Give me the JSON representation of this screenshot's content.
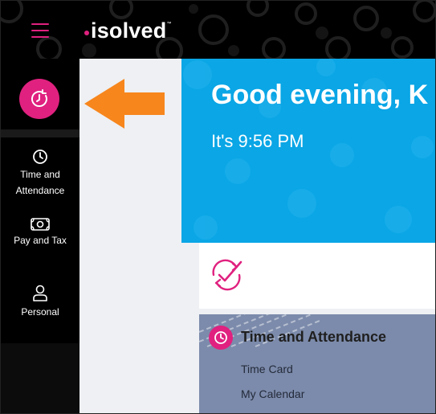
{
  "app": {
    "logo_text": "isolved",
    "logo_tm": "™"
  },
  "icons": {
    "menu": "hamburger-menu-icon",
    "active_nav": "clock-refresh-icon",
    "time": "clock-icon",
    "pay": "money-icon",
    "personal": "person-icon",
    "annotation": "arrow-left-icon",
    "check": "check-refresh-icon"
  },
  "colors": {
    "brand_pink": "#e0217f",
    "hero_blue": "#0aa6e6",
    "arrow_orange": "#f7861d",
    "card_slate": "#7c8bab"
  },
  "sidebar": {
    "items": [
      {
        "label_line1": "Time and",
        "label_line2": "Attendance"
      },
      {
        "label": "Pay and Tax"
      },
      {
        "label": "Personal"
      }
    ]
  },
  "hero": {
    "greeting": "Good evening, K",
    "time_text": "It's 9:56 PM"
  },
  "time_attendance_card": {
    "title": "Time and Attendance",
    "links": [
      "Time Card",
      "My Calendar"
    ]
  }
}
